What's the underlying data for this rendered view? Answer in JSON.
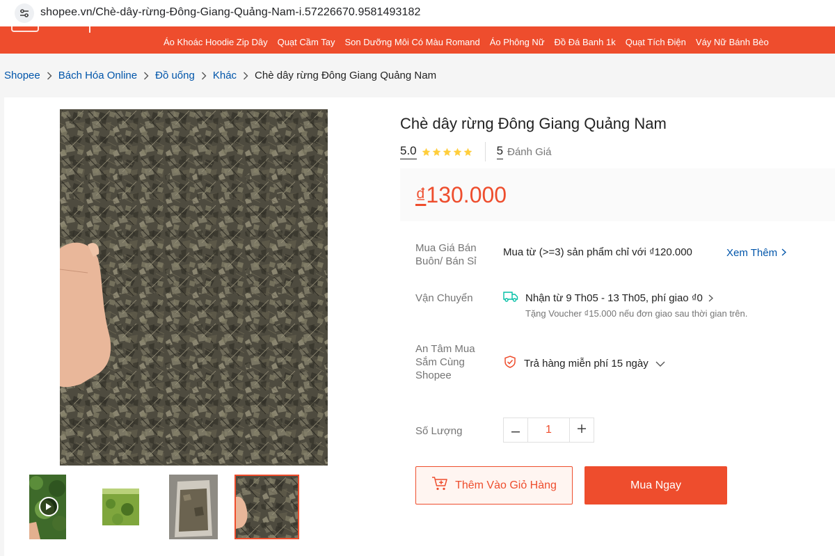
{
  "browser": {
    "url": "shopee.vn/Chè-dây-rừng-Đông-Giang-Quảng-Nam-i.57226670.9581493182"
  },
  "header": {
    "keywords": [
      "Áo Khoác Hoodie Zip Dây",
      "Quạt Cầm Tay",
      "Son Dưỡng Môi Có Màu Romand",
      "Áo Phông Nữ",
      "Đồ Đá Banh 1k",
      "Quạt Tích Điện",
      "Váy Nữ Bánh Bèo"
    ]
  },
  "breadcrumb": {
    "items": [
      "Shopee",
      "Bách Hóa Online",
      "Đồ uống",
      "Khác"
    ],
    "current": "Chè dây rừng Đông Giang Quảng Nam"
  },
  "product": {
    "title": "Chè dây rừng Đông Giang Quảng Nam",
    "rating": "5.0",
    "rating_stars": 5,
    "review_count": "5",
    "review_label": "Đánh Giá",
    "price_currency": "₫",
    "price_amount": "130.000"
  },
  "wholesale": {
    "label": "Mua Giá Bán Buôn/ Bán Sỉ",
    "text": "Mua từ (>=3) sản phẩm chỉ với ₫120.000",
    "see_more": "Xem Thêm"
  },
  "shipping": {
    "label": "Vận Chuyển",
    "text": "Nhận từ 9 Th05 - 13 Th05, phí giao ₫0",
    "sub": "Tặng Voucher ₫15.000 nếu đơn giao sau thời gian trên."
  },
  "assurance": {
    "label": "An Tâm Mua Sắm Cùng Shopee",
    "text": "Trả hàng miễn phí 15 ngày"
  },
  "quantity": {
    "label": "Số Lượng",
    "value": "1"
  },
  "actions": {
    "add_to_cart": "Thêm Vào Giỏ Hàng",
    "buy_now": "Mua Ngay"
  },
  "colors": {
    "brand": "#ee4d2d",
    "link": "#0055aa",
    "star": "#ffce3d",
    "shipping_icon": "#00bfa5"
  }
}
